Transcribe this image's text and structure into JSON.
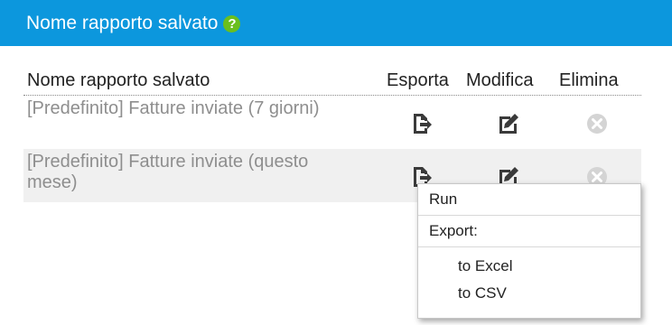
{
  "header": {
    "title": "Nome rapporto salvato",
    "help_icon": "question-circle-icon",
    "help_glyph": "?",
    "background_color": "#0c97dd",
    "help_color": "#6abf1e"
  },
  "table": {
    "columns": {
      "name": "Nome rapporto salvato",
      "export": "Esporta",
      "edit": "Modifica",
      "delete": "Elimina"
    },
    "rows": [
      {
        "name": "[Predefinito] Fatture inviate (7 giorni)",
        "export_icon": "export-icon",
        "edit_icon": "edit-icon",
        "delete_icon": "delete-icon"
      },
      {
        "name": "[Predefinito] Fatture inviate (questo mese)",
        "export_icon": "export-icon",
        "edit_icon": "edit-icon",
        "delete_icon": "delete-icon"
      }
    ]
  },
  "context_menu": {
    "items": [
      {
        "label": "Run"
      },
      {
        "label": "Export:"
      },
      {
        "label": "to Excel"
      },
      {
        "label": "to CSV"
      }
    ]
  }
}
